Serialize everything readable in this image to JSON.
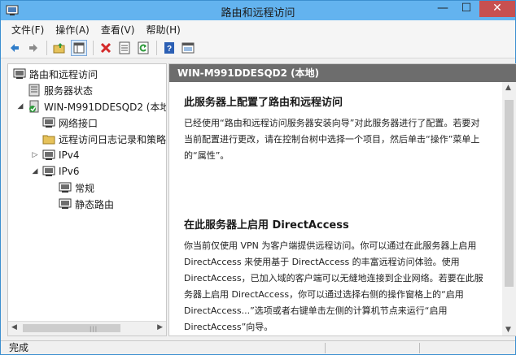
{
  "window": {
    "title": "路由和远程访问",
    "controls": {
      "minimize": "—",
      "maximize": "☐",
      "close": "✕"
    }
  },
  "menu": [
    "文件(F)",
    "操作(A)",
    "查看(V)",
    "帮助(H)"
  ],
  "toolbar": {
    "icons": [
      "back-arrow-icon",
      "forward-arrow-icon",
      "up-folder-icon",
      "show-hide-tree-icon",
      "delete-icon",
      "properties-icon",
      "refresh-icon",
      "help-icon",
      "console-icon"
    ]
  },
  "tree": {
    "root": "路由和远程访问",
    "server_status": "服务器状态",
    "server": "WIN-M991DDESQD2 (本地",
    "network_interfaces": "网络接口",
    "remote_logging": "远程访问日志记录和策略",
    "ipv4": "IPv4",
    "ipv6": "IPv6",
    "general": "常规",
    "static_routes": "静态路由"
  },
  "detail": {
    "header": "WIN-M991DDESQD2 (本地)",
    "section1_title": "此服务器上配置了路由和远程访问",
    "section1_text": "已经使用“路由和远程访问服务器安装向导”对此服务器进行了配置。若要对当前配置进行更改，请在控制台树中选择一个项目，然后单击“操作”菜单上的“属性”。",
    "section2_title": "在此服务器上启用 DirectAccess",
    "section2_text": "你当前仅使用 VPN 为客户端提供远程访问。你可以通过在此服务器上启用 DirectAccess 来使用基于 DirectAccess 的丰富远程访问体验。使用 DirectAccess，已加入域的客户端可以无缝地连接到企业网络。若要在此服务器上启用 DirectAccess，你可以通过选择右侧的操作窗格上的“启用 DirectAccess...”选项或者右键单击左侧的计算机节点来运行“启用 DirectAccess”向导。"
  },
  "status": {
    "text": "完成"
  },
  "colors": {
    "titlebar": "#63b3ef",
    "close": "#c75050",
    "header": "#6d6d6d"
  }
}
